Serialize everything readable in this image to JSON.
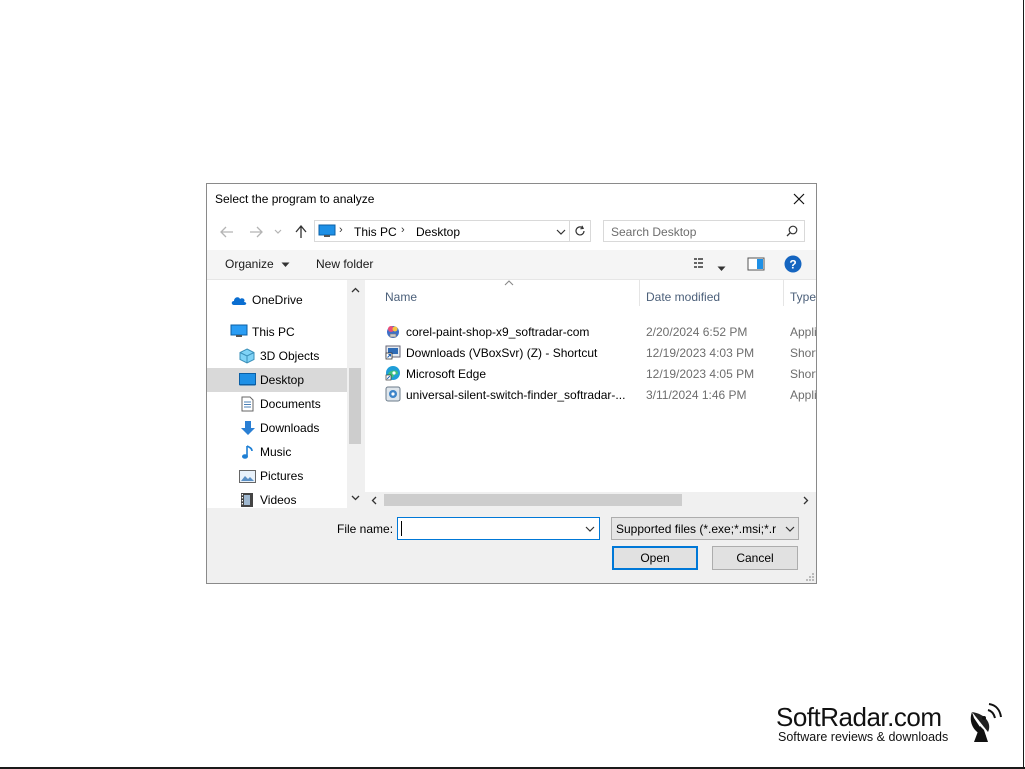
{
  "dialog": {
    "title": "Select the program to analyze"
  },
  "address_bar": {
    "crumbs": [
      "This PC",
      "Desktop"
    ]
  },
  "search": {
    "placeholder": "Search Desktop"
  },
  "toolbar": {
    "organize_label": "Organize",
    "new_folder_label": "New folder"
  },
  "nav_pane": {
    "items": [
      {
        "label": "OneDrive",
        "icon": "cloud-icon"
      },
      {
        "label": "This PC",
        "icon": "computer-icon"
      },
      {
        "label": "3D Objects",
        "icon": "cube-icon"
      },
      {
        "label": "Desktop",
        "icon": "desktop-icon",
        "selected": true
      },
      {
        "label": "Documents",
        "icon": "document-icon"
      },
      {
        "label": "Downloads",
        "icon": "download-arrow-icon"
      },
      {
        "label": "Music",
        "icon": "music-note-icon"
      },
      {
        "label": "Pictures",
        "icon": "picture-icon"
      },
      {
        "label": "Videos",
        "icon": "film-icon"
      }
    ]
  },
  "file_list": {
    "columns": [
      "Name",
      "Date modified",
      "Type"
    ],
    "rows": [
      {
        "name": "corel-paint-shop-x9_softradar-com",
        "date": "2/20/2024 6:52 PM",
        "type": "Appli",
        "icon": "installer-icon"
      },
      {
        "name": "Downloads (VBoxSvr) (Z) - Shortcut",
        "date": "12/19/2023 4:03 PM",
        "type": "Short",
        "icon": "shortcut-icon"
      },
      {
        "name": "Microsoft Edge",
        "date": "12/19/2023 4:05 PM",
        "type": "Short",
        "icon": "edge-icon"
      },
      {
        "name": "universal-silent-switch-finder_softradar-...",
        "date": "3/11/2024 1:46 PM",
        "type": "Appli",
        "icon": "app-icon"
      }
    ]
  },
  "bottom": {
    "file_name_label": "File name:",
    "file_name_value": "",
    "filter_value": "Supported files (*.exe;*.msi;*.re",
    "open_label": "Open",
    "cancel_label": "Cancel"
  },
  "watermark": {
    "title": "SoftRadar.com",
    "subtitle": "Software reviews & downloads"
  },
  "colors": {
    "accent": "#0078d7",
    "selection": "#d9d9d9",
    "help": "#1565c0"
  }
}
